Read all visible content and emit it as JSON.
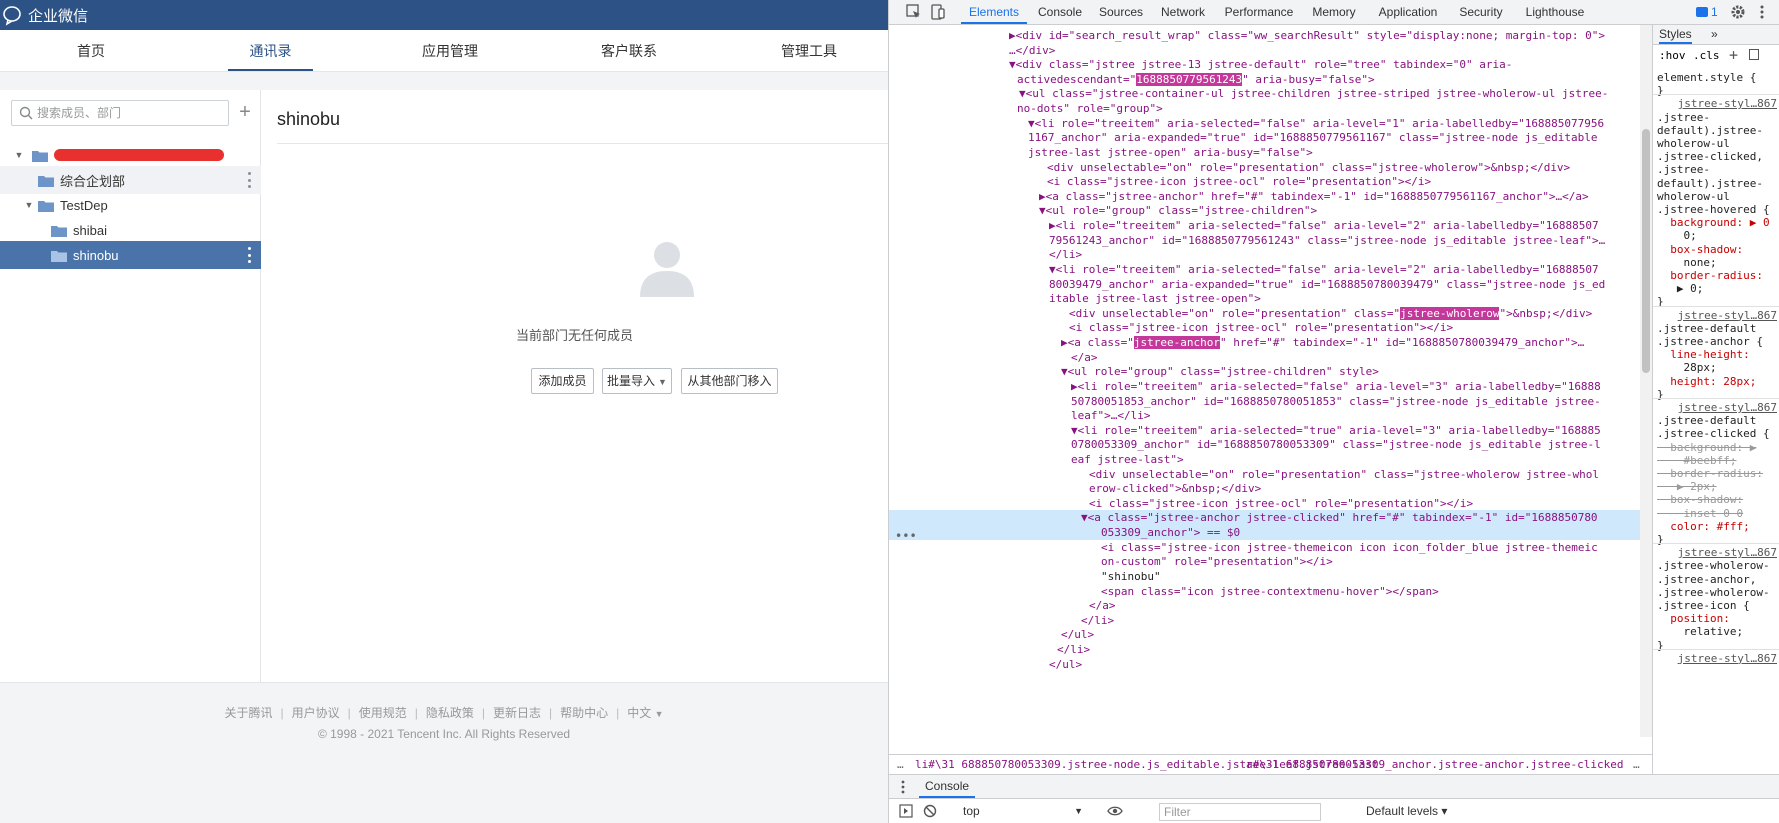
{
  "app": {
    "title": "企业微信",
    "nav_tabs": [
      {
        "label": "首页"
      },
      {
        "label": "通讯录",
        "active": true
      },
      {
        "label": "应用管理"
      },
      {
        "label": "客户联系"
      },
      {
        "label": "管理工具"
      }
    ],
    "search_placeholder": "搜索成员、部门",
    "add_symbol": "+",
    "tree": [
      {
        "label": "",
        "level": 0,
        "expanded": true,
        "redacted": true
      },
      {
        "label": "综合企划部",
        "level": 1
      },
      {
        "label": "TestDep",
        "level": 1,
        "expanded": true
      },
      {
        "label": "shibai",
        "level": 2
      },
      {
        "label": "shinobu",
        "level": 2,
        "selected": true
      }
    ],
    "selected_dept": "shinobu",
    "empty_message": "当前部门无任何成员",
    "buttons": {
      "add_member": "添加成员",
      "batch_import": "批量导入",
      "move_from_other": "从其他部门移入"
    },
    "footer_links": [
      "关于腾讯",
      "用户协议",
      "使用规范",
      "隐私政策",
      "更新日志",
      "帮助中心",
      "中文"
    ],
    "copyright": "© 1998 - 2021 Tencent Inc. All Rights Reserved"
  },
  "devtools": {
    "tabs": [
      "Elements",
      "Console",
      "Sources",
      "Network",
      "Performance",
      "Memory",
      "Application",
      "Security",
      "Lighthouse"
    ],
    "active_tab": "Elements",
    "issue_count": "1",
    "dom_lines": [
      "▶<div id=\"search_result_wrap\" class=\"ww_searchResult\" style=\"display:none; margin-top: 0\">",
      "…</div>",
      "▼<div class=\"jstree jstree-13 jstree-default\" role=\"tree\" tabindex=\"0\" aria-",
      "activedescendant=\"1688850779561243\" aria-busy=\"false\">",
      "▼<ul class=\"jstree-container-ul jstree-children jstree-striped jstree-wholerow-ul jstree-",
      "no-dots\" role=\"group\">",
      "▼<li role=\"treeitem\" aria-selected=\"false\" aria-level=\"1\" aria-labelledby=\"168885077956",
      "1167_anchor\" aria-expanded=\"true\" id=\"1688850779561167\" class=\"jstree-node js_editable",
      "jstree-last jstree-open\" aria-busy=\"false\">",
      "<div unselectable=\"on\" role=\"presentation\" class=\"jstree-wholerow\">&nbsp;</div>",
      "<i class=\"jstree-icon jstree-ocl\" role=\"presentation\"></i>",
      "▶<a class=\"jstree-anchor\" href=\"#\" tabindex=\"-1\" id=\"1688850779561167_anchor\">…</a>",
      "▼<ul role=\"group\" class=\"jstree-children\">",
      "▶<li role=\"treeitem\" aria-selected=\"false\" aria-level=\"2\" aria-labelledby=\"16888507",
      "79561243_anchor\" id=\"1688850779561243\" class=\"jstree-node js_editable jstree-leaf\">…",
      "</li>",
      "▼<li role=\"treeitem\" aria-selected=\"false\" aria-level=\"2\" aria-labelledby=\"16888507",
      "80039479_anchor\" aria-expanded=\"true\" id=\"1688850780039479\" class=\"jstree-node js_ed",
      "itable jstree-last jstree-open\">",
      "<div unselectable=\"on\" role=\"presentation\" class=\"jstree-wholerow\">&nbsp;</div>",
      "<i class=\"jstree-icon jstree-ocl\" role=\"presentation\"></i>",
      "▶<a class=\"jstree-anchor\" href=\"#\" tabindex=\"-1\" id=\"1688850780039479_anchor\">…",
      "</a>",
      "▼<ul role=\"group\" class=\"jstree-children\" style>",
      "▶<li role=\"treeitem\" aria-selected=\"false\" aria-level=\"3\" aria-labelledby=\"16888",
      "50780051853_anchor\" id=\"1688850780051853\" class=\"jstree-node js_editable jstree-",
      "leaf\">…</li>",
      "▼<li role=\"treeitem\" aria-selected=\"true\" aria-level=\"3\" aria-labelledby=\"168885",
      "0780053309_anchor\" id=\"1688850780053309\" class=\"jstree-node js_editable jstree-l",
      "eaf jstree-last\">",
      "<div unselectable=\"on\" role=\"presentation\" class=\"jstree-wholerow jstree-whol",
      "erow-clicked\">&nbsp;</div>",
      "<i class=\"jstree-icon jstree-ocl\" role=\"presentation\"></i>",
      "▼<a class=\"jstree-anchor jstree-clicked\" href=\"#\" tabindex=\"-1\" id=\"1688850780",
      "053309_anchor\"> == $0",
      "<i class=\"jstree-icon jstree-themeicon icon icon_folder_blue jstree-themeic",
      "on-custom\" role=\"presentation\"></i>",
      "\"shinobu\"",
      "<span class=\"icon jstree-contextmenu-hover\"></span>",
      "</a>",
      "</li>",
      "</ul>",
      "</li>",
      "</ul>"
    ],
    "breadcrumb": [
      "li#\\31 688850780053309.jstree-node.js_editable.jstree-leaf.jstree-last",
      "a#\\31 688850780053309_anchor.jstree-anchor.jstree-clicked"
    ],
    "styles": {
      "tab": "Styles",
      "more": "»",
      "filter_hov": ":hov",
      "filter_cls": ".cls",
      "lines": [
        {
          "t": "element.style {",
          "c": "sel"
        },
        {
          "t": "}",
          "c": "sel"
        },
        {
          "t": "jstree-styl…867",
          "c": "src"
        },
        {
          "t": ".jstree-",
          "c": "sel"
        },
        {
          "t": "default).jstree-",
          "c": "sel"
        },
        {
          "t": "wholerow-ul",
          "c": "sel"
        },
        {
          "t": ".jstree-clicked,",
          "c": "sel"
        },
        {
          "t": ".jstree-",
          "c": "sel"
        },
        {
          "t": "default).jstree-",
          "c": "sel"
        },
        {
          "t": "wholerow-ul",
          "c": "sel"
        },
        {
          "t": ".jstree-hovered {",
          "c": "sel"
        },
        {
          "t": "  background: ▶ 0",
          "c": "prop"
        },
        {
          "t": "    0;",
          "c": "val"
        },
        {
          "t": "  box-shadow:",
          "c": "prop"
        },
        {
          "t": "    none;",
          "c": "val"
        },
        {
          "t": "  border-radius:",
          "c": "prop"
        },
        {
          "t": "   ▶ 0;",
          "c": "val"
        },
        {
          "t": "}",
          "c": "sel"
        },
        {
          "t": "jstree-styl…867",
          "c": "src"
        },
        {
          "t": ".jstree-default",
          "c": "sel"
        },
        {
          "t": ".jstree-anchor {",
          "c": "sel"
        },
        {
          "t": "  line-height:",
          "c": "prop"
        },
        {
          "t": "    28px;",
          "c": "val"
        },
        {
          "t": "  height: 28px;",
          "c": "prop"
        },
        {
          "t": "}",
          "c": "sel"
        },
        {
          "t": "jstree-styl…867",
          "c": "src"
        },
        {
          "t": ".jstree-default",
          "c": "sel"
        },
        {
          "t": ".jstree-clicked {",
          "c": "sel"
        },
        {
          "t": "  background: ▶",
          "c": "struck"
        },
        {
          "t": "    #beebff;",
          "c": "struck"
        },
        {
          "t": "  border-radius:",
          "c": "struck"
        },
        {
          "t": "   ▶ 2px;",
          "c": "struck"
        },
        {
          "t": "  box-shadow:",
          "c": "struck"
        },
        {
          "t": "    inset 0 0",
          "c": "struck"
        },
        {
          "t": "  color: #fff;",
          "c": "prop"
        },
        {
          "t": "}",
          "c": "sel"
        },
        {
          "t": "jstree-styl…867",
          "c": "src"
        },
        {
          "t": ".jstree-wholerow-",
          "c": "sel"
        },
        {
          "t": ".jstree-anchor,",
          "c": "sel"
        },
        {
          "t": ".jstree-wholerow-",
          "c": "sel"
        },
        {
          "t": ".jstree-icon {",
          "c": "sel"
        },
        {
          "t": "  position:",
          "c": "prop"
        },
        {
          "t": "    relative;",
          "c": "val"
        },
        {
          "t": "}",
          "c": "sel"
        },
        {
          "t": "jstree-styl…867",
          "c": "src"
        }
      ]
    },
    "drawer": {
      "console_tab": "Console",
      "context": "top",
      "filter_placeholder": "Filter",
      "levels": "Default levels ▾"
    }
  }
}
